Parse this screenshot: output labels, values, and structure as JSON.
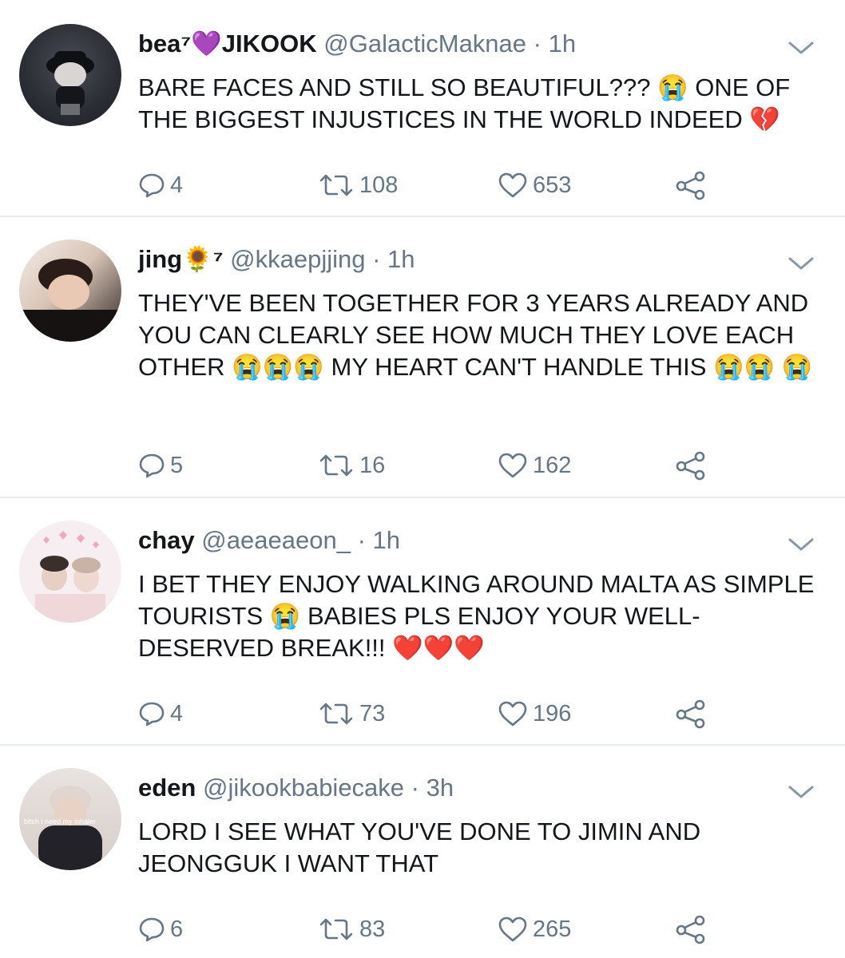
{
  "tweets": [
    {
      "display_name": "bea⁷💜JIKOOK",
      "handle": "@GalacticMaknae",
      "separator": "·",
      "time": "1h",
      "text": "BARE FACES AND STILL SO BEAUTIFUL??? 😭 ONE OF THE BIGGEST INJUSTICES IN THE WORLD INDEED 💔",
      "replies": "4",
      "retweets": "108",
      "likes": "653"
    },
    {
      "display_name": "jing🌻⁷",
      "handle": "@kkaepjjing",
      "separator": "·",
      "time": "1h",
      "text": "THEY'VE BEEN TOGETHER FOR 3 YEARS ALREADY AND YOU CAN CLEARLY SEE HOW MUCH THEY LOVE EACH OTHER 😭😭😭 MY HEART CAN'T HANDLE THIS 😭😭 😭",
      "replies": "5",
      "retweets": "16",
      "likes": "162"
    },
    {
      "display_name": "chay",
      "handle": "@aeaeaeon_",
      "separator": "·",
      "time": "1h",
      "text": "I BET THEY ENJOY WALKING AROUND MALTA AS SIMPLE TOURISTS 😭 BABIES PLS ENJOY YOUR WELL-DESERVED BREAK!!! ❤️❤️❤️",
      "replies": "4",
      "retweets": "73",
      "likes": "196"
    },
    {
      "display_name": "eden",
      "handle": "@jikookbabiecake",
      "separator": "·",
      "time": "3h",
      "text": "LORD I SEE WHAT YOU'VE DONE TO JIMIN AND JEONGGUK I WANT THAT",
      "replies": "6",
      "retweets": "83",
      "likes": "265"
    }
  ],
  "avatar_caption": "bitch i need my inhaler",
  "icons": {
    "reply": "reply-icon",
    "retweet": "retweet-icon",
    "like": "heart-icon",
    "share": "share-icon",
    "menu": "chevron-down-icon"
  },
  "colors": {
    "text": "#14171a",
    "muted": "#657786",
    "divider": "#e6ecf0"
  }
}
